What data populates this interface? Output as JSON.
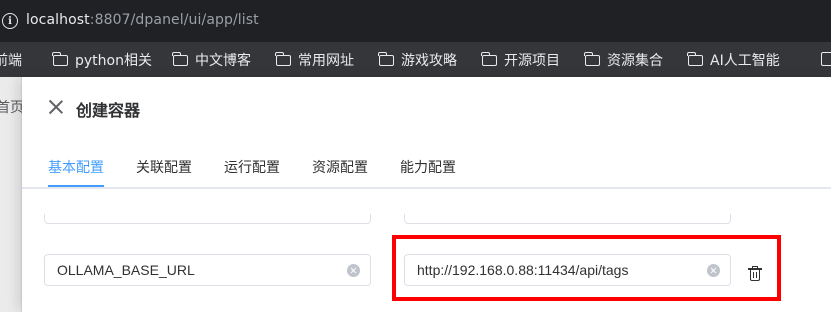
{
  "browser": {
    "url_host": "localhost",
    "url_rest": ":8807/dpanel/ui/app/list"
  },
  "bookmarks": [
    {
      "label": "前端",
      "icon": "none"
    },
    {
      "label": "python相关",
      "icon": "folder-icon"
    },
    {
      "label": "中文博客",
      "icon": "folder-icon"
    },
    {
      "label": "常用网址",
      "icon": "folder-icon"
    },
    {
      "label": "游戏攻略",
      "icon": "folder-icon"
    },
    {
      "label": "开源项目",
      "icon": "folder-icon"
    },
    {
      "label": "资源集合",
      "icon": "folder-icon"
    },
    {
      "label": "AI人工智能",
      "icon": "folder-icon"
    }
  ],
  "page_behind": {
    "partial_label": "首页"
  },
  "drawer": {
    "title": "创建容器",
    "tabs": [
      {
        "label": "基本配置",
        "active": true
      },
      {
        "label": "关联配置",
        "active": false
      },
      {
        "label": "运行配置",
        "active": false
      },
      {
        "label": "资源配置",
        "active": false
      },
      {
        "label": "能力配置",
        "active": false
      }
    ],
    "env_row": {
      "name": "OLLAMA_BASE_URL",
      "value": "http://192.168.0.88:11434/api/tags"
    }
  },
  "colors": {
    "accent": "#409eff",
    "highlight": "#ff0000",
    "chrome_dark": "#202124",
    "bookmarks_bg": "#35363a"
  }
}
